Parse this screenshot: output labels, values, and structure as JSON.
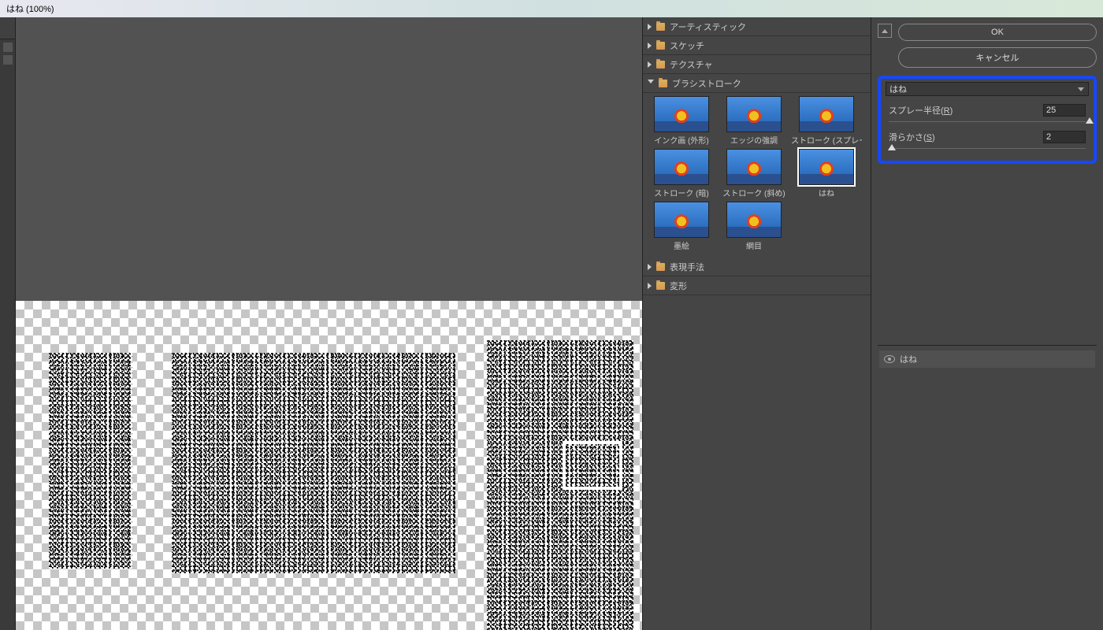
{
  "title": "はね (100%)",
  "categories": [
    {
      "label": "アーティスティック",
      "open": false
    },
    {
      "label": "スケッチ",
      "open": false
    },
    {
      "label": "テクスチャ",
      "open": false
    },
    {
      "label": "ブラシストローク",
      "open": true
    },
    {
      "label": "表現手法",
      "open": false
    },
    {
      "label": "変形",
      "open": false
    }
  ],
  "thumbs": [
    {
      "label": "インク画 (外形)"
    },
    {
      "label": "エッジの強調"
    },
    {
      "label": "ストローク (スプレー)"
    },
    {
      "label": "ストローク (暗)"
    },
    {
      "label": "ストローク (斜め)"
    },
    {
      "label": "はね",
      "selected": true
    },
    {
      "label": "墨絵"
    },
    {
      "label": "網目"
    }
  ],
  "buttons": {
    "ok": "OK",
    "cancel": "キャンセル"
  },
  "current_filter": "はね",
  "params": {
    "spray": {
      "label": "スプレー半径",
      "key": "R",
      "value": "25",
      "pos": 98
    },
    "smooth": {
      "label": "滑らかさ",
      "key": "S",
      "value": "2",
      "pos": 5
    }
  },
  "layer": {
    "label": "はね"
  }
}
